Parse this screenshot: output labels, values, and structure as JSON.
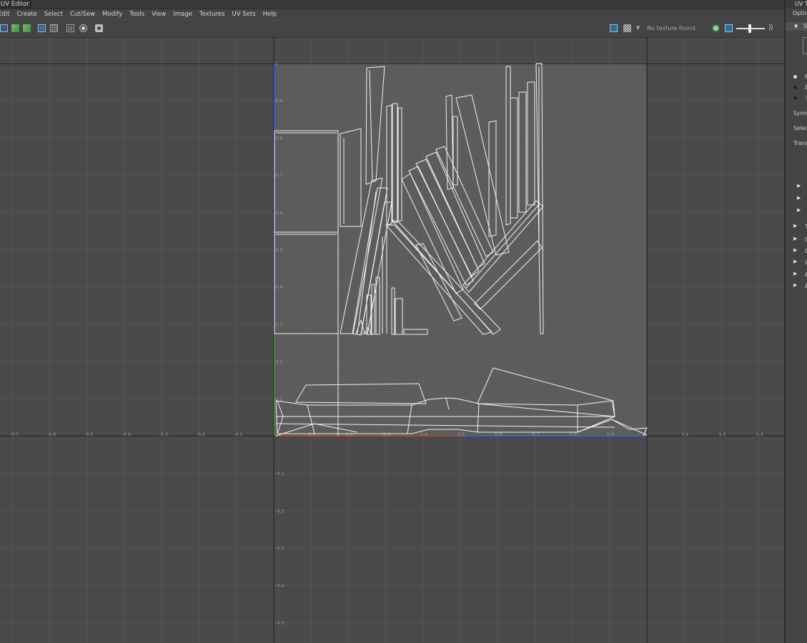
{
  "window": {
    "title": "UV Editor"
  },
  "menu": [
    "Edit",
    "Create",
    "Select",
    "Cut/Sew",
    "Modify",
    "Tools",
    "View",
    "Image",
    "Textures",
    "UV Sets",
    "Help"
  ],
  "toolbar": {
    "texture_status": "No texture found"
  },
  "grid": {
    "x_ticks": [
      "-0.7",
      "-0.6",
      "-0.5",
      "-0.4",
      "-0.3",
      "-0.2",
      "-0.1",
      "0.1",
      "0.2",
      "0.3",
      "0.4",
      "0.5",
      "0.6",
      "0.7",
      "0.8",
      "0.9",
      "1",
      "1.1",
      "1.2",
      "1.3"
    ],
    "y_ticks": [
      "1",
      "0.9",
      "0.8",
      "0.7",
      "0.6",
      "0.5",
      "0.4",
      "0.3",
      "0.2",
      "0.1",
      "-0.1",
      "-0.2",
      "-0.3",
      "-0.4",
      "-0.5"
    ],
    "colors": {
      "u_axis": "#d03c3c",
      "v_axis": "#3c9c3c",
      "edge": "#3f5fd8",
      "wire": "#f2f2f2"
    }
  },
  "side_panel": {
    "title": "UV To",
    "options": "Optio",
    "section_title": "S",
    "radio_labels": [
      "P",
      "D",
      "T"
    ],
    "field_labels": [
      "Symm",
      "Selec",
      "Trans"
    ],
    "rows": [
      "T",
      "C",
      "C",
      "U",
      "A",
      "A"
    ]
  }
}
